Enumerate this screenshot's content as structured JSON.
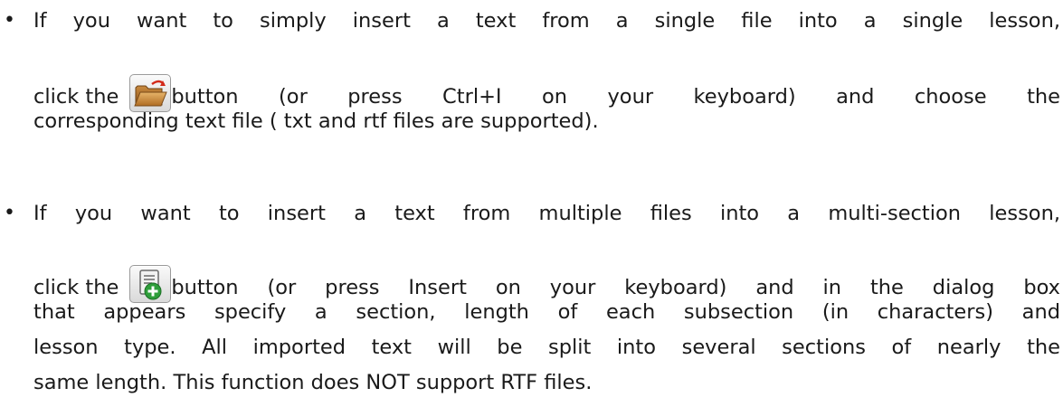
{
  "items": [
    {
      "line1": "If you want to simply insert a text from a single file into a single lesson,",
      "line2_a": "click the",
      "line2_b": "button (or press Ctrl+I on your keyboard) and choose the",
      "line3": "corresponding text file ( txt and rtf files are supported).",
      "icon": "open-folder-icon"
    },
    {
      "line1": "If you want to insert a text from multiple files into a multi-section lesson,",
      "line2_a": "click the",
      "line2_b": "button (or press Insert on your keyboard) and in the dialog box",
      "line3": "that appears specify a section, length of each subsection (in characters) and",
      "line4": "lesson type. All imported text will be split into several sections of nearly the",
      "line5": "same length. This function does NOT support RTF files.",
      "icon": "add-document-icon"
    }
  ],
  "bullet": "•"
}
